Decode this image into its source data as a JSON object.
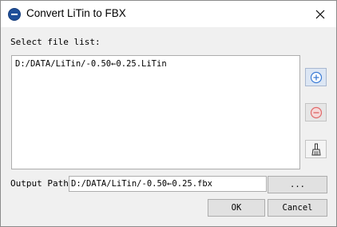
{
  "window": {
    "title": "Convert LiTin to FBX",
    "logo_icon": "app-logo-icon",
    "close_icon": "close-icon"
  },
  "file_list": {
    "label": "Select file list:",
    "items": [
      "D:/DATA/LiTin/-0.50←0.25.LiTin"
    ]
  },
  "side_buttons": {
    "add_icon": "plus-circle-icon",
    "remove_icon": "minus-circle-icon",
    "clear_icon": "broom-icon",
    "add_color": "#3a7bd5",
    "remove_color": "#e06a6a"
  },
  "output": {
    "label": "Output Path:",
    "value": "D:/DATA/LiTin/-0.50←0.25.fbx",
    "browse_label": "..."
  },
  "footer": {
    "ok_label": "OK",
    "cancel_label": "Cancel"
  }
}
